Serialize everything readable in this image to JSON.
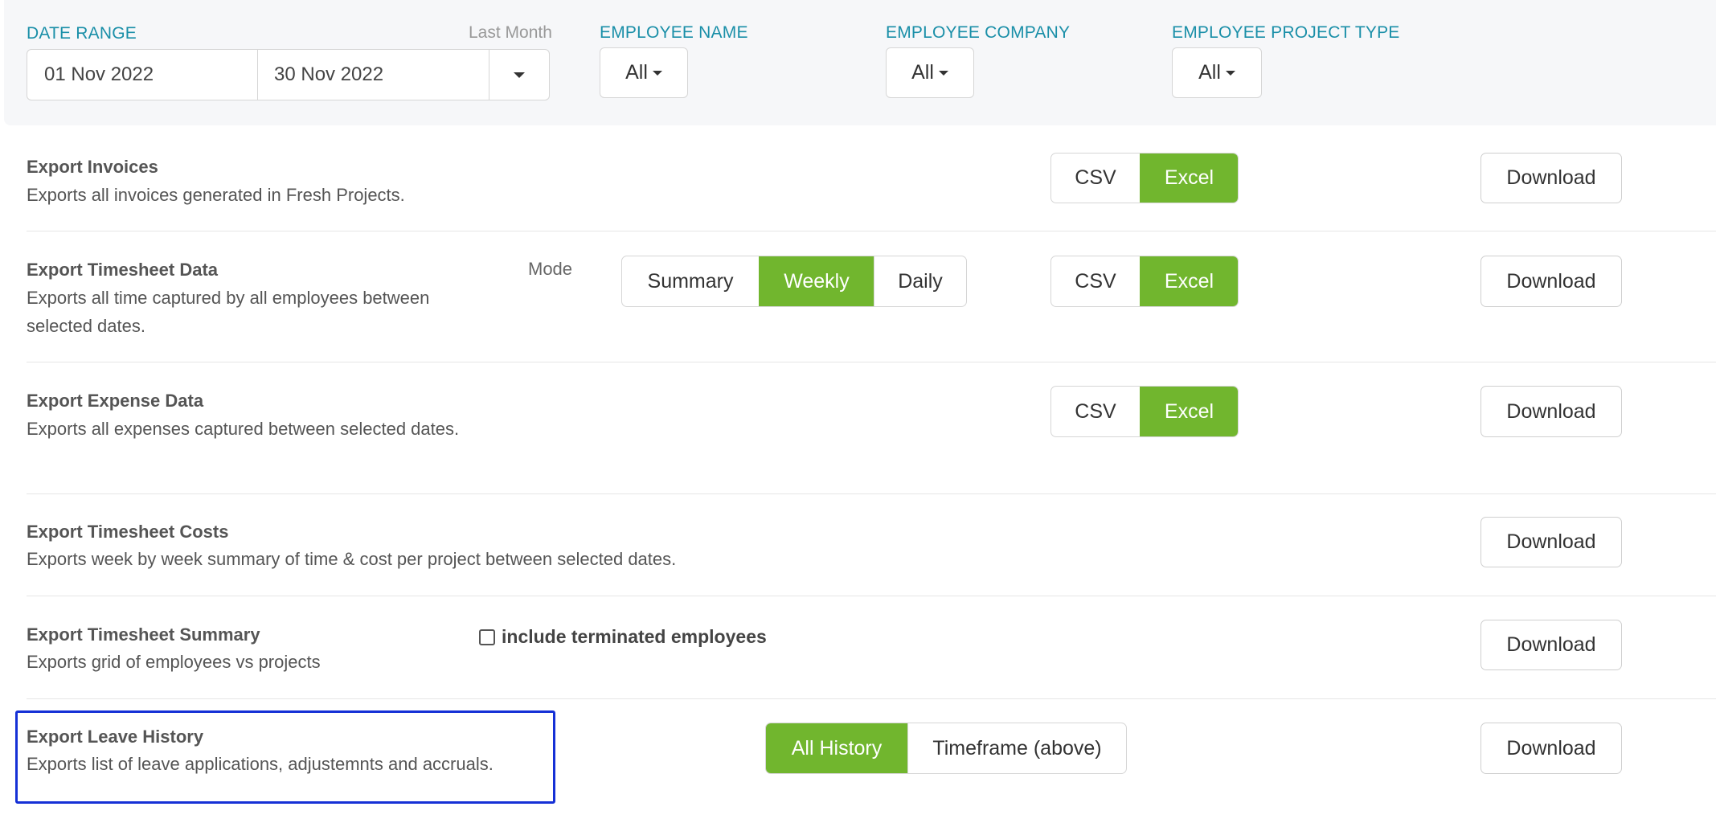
{
  "filters": {
    "date_range": {
      "label": "DATE RANGE",
      "hint": "Last Month",
      "from": "01 Nov 2022",
      "to": "30 Nov 2022"
    },
    "employee_name": {
      "label": "EMPLOYEE NAME",
      "value": "All"
    },
    "employee_company": {
      "label": "EMPLOYEE COMPANY",
      "value": "All"
    },
    "employee_project_type": {
      "label": "EMPLOYEE PROJECT TYPE",
      "value": "All"
    }
  },
  "format_options": {
    "csv": "CSV",
    "excel": "Excel",
    "selected": "Excel"
  },
  "download_label": "Download",
  "rows": {
    "invoices": {
      "title": "Export Invoices",
      "description": "Exports all invoices generated in Fresh Projects."
    },
    "timesheet_data": {
      "title": "Export Timesheet Data",
      "description": "Exports all time captured by all employees between selected dates.",
      "mode_label": "Mode",
      "modes": [
        "Summary",
        "Weekly",
        "Daily"
      ],
      "selected_mode": "Weekly"
    },
    "expense_data": {
      "title": "Export Expense Data",
      "description": "Exports all expenses captured between selected dates."
    },
    "timesheet_costs": {
      "title": "Export Timesheet Costs",
      "description": "Exports week by week summary of time & cost per project between selected dates."
    },
    "timesheet_summary": {
      "title": "Export Timesheet Summary",
      "description": "Exports grid of employees vs projects",
      "checkbox_label": "include terminated employees",
      "checkbox_checked": false
    },
    "leave_history": {
      "title": "Export Leave History",
      "description": "Exports list of leave applications, adjustemnts and accruals.",
      "options": [
        "All History",
        "Timeframe (above)"
      ],
      "selected_option": "All History"
    }
  },
  "colors": {
    "accent_green": "#71b62e",
    "label_teal": "#1a8fa8",
    "highlight_blue": "#1530d6"
  }
}
